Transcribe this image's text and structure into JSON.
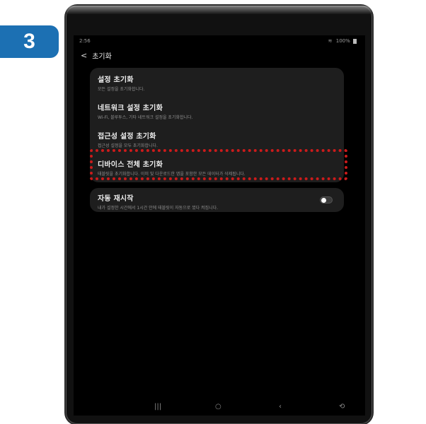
{
  "step_number": "3",
  "status_bar": {
    "time": "2:56",
    "battery": "100%"
  },
  "header": {
    "title": "초기화",
    "back_icon": "chevron-left-icon"
  },
  "reset_items": [
    {
      "title": "설정 초기화",
      "subtitle": "모든 설정을 초기화합니다."
    },
    {
      "title": "네트워크 설정 초기화",
      "subtitle": "Wi-Fi, 블루투스, 기타 네트워크 설정을 초기화합니다."
    },
    {
      "title": "접근성 설정 초기화",
      "subtitle": "접근성 설정을 모두 초기화합니다."
    },
    {
      "title": "디바이스 전체 초기화",
      "subtitle": "태블릿을 초기화합니다. 이미 및 다운로드한 앱을 포함한 모든 데이터가 삭제됩니다."
    }
  ],
  "auto_restart": {
    "title": "자동 재시작",
    "subtitle": "내가 설정한 시간에서 1시간 안에 태블릿이 자동으로 껐다 켜집니다.",
    "enabled": false
  },
  "navbar": {
    "recents": "|||",
    "home": "○",
    "back": "‹"
  },
  "colors": {
    "badge": "#1c70b3",
    "highlight": "#cc1b1b",
    "screen_bg": "#000000",
    "card_bg": "#1e1e1e"
  }
}
